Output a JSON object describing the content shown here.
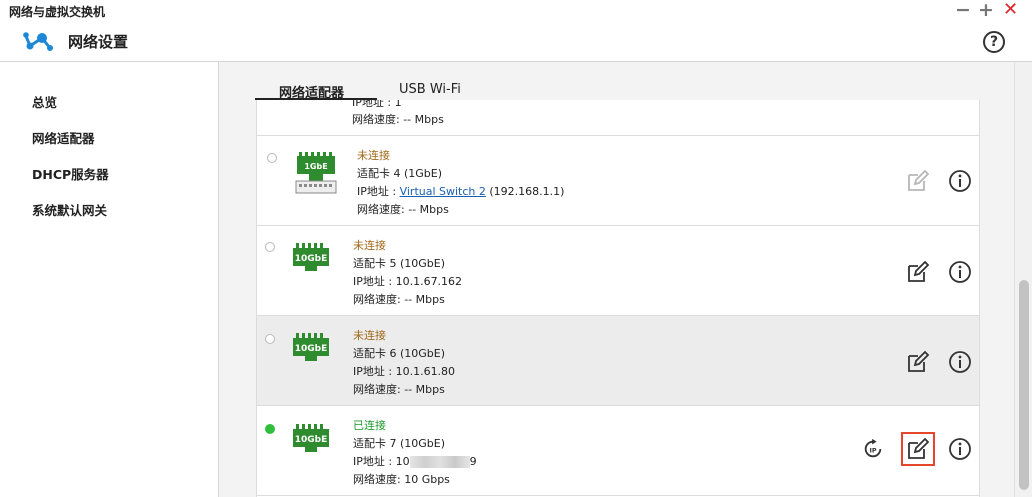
{
  "window": {
    "title": "网络与虚拟交换机",
    "minimize": "−",
    "maximize": "+",
    "close": "✕"
  },
  "header": {
    "title": "网络设置",
    "help": "?",
    "logo_icon": "network-topology-icon"
  },
  "sidebar": {
    "items": [
      "总览",
      "网络适配器",
      "DHCP服务器",
      "系统默认网关"
    ]
  },
  "tabs": [
    {
      "label": "网络适配器",
      "active": true
    },
    {
      "label": "USB Wi-Fi",
      "active": false
    }
  ],
  "partial_card": {
    "ip_label": "IP地址 : 1",
    "speed": "网络速度: -- Mbps"
  },
  "adapters": [
    {
      "status": "未连接",
      "adapter": "适配卡 4 (1GbE)",
      "ip_label": "IP地址 : ",
      "ip_link": "Virtual Switch 2",
      "ip_suffix": " (192.168.1.1)",
      "speed": "网络速度: -- Mbps",
      "nic_label": "1GbE",
      "connected": false
    },
    {
      "status": "未连接",
      "adapter": "适配卡 5 (10GbE)",
      "ip": "IP地址 : 10.1.67.162",
      "speed": "网络速度: -- Mbps",
      "nic_label": "10GbE",
      "connected": false
    },
    {
      "status": "未连接",
      "adapter": "适配卡 6 (10GbE)",
      "ip": "IP地址 : 10.1.61.80",
      "speed": "网络速度: -- Mbps",
      "nic_label": "10GbE",
      "connected": false
    },
    {
      "status": "已连接",
      "adapter": "适配卡 7 (10GbE)",
      "ip_prefix": "IP地址 : 10",
      "ip_suffix": "9",
      "speed": "网络速度: 10 Gbps",
      "nic_label": "10GbE",
      "connected": true
    }
  ],
  "colors": {
    "nic_green": "#2e8b2e",
    "disconnected": "#a0681a",
    "connected": "#1d9a2b",
    "highlight_border": "#e8462a"
  }
}
